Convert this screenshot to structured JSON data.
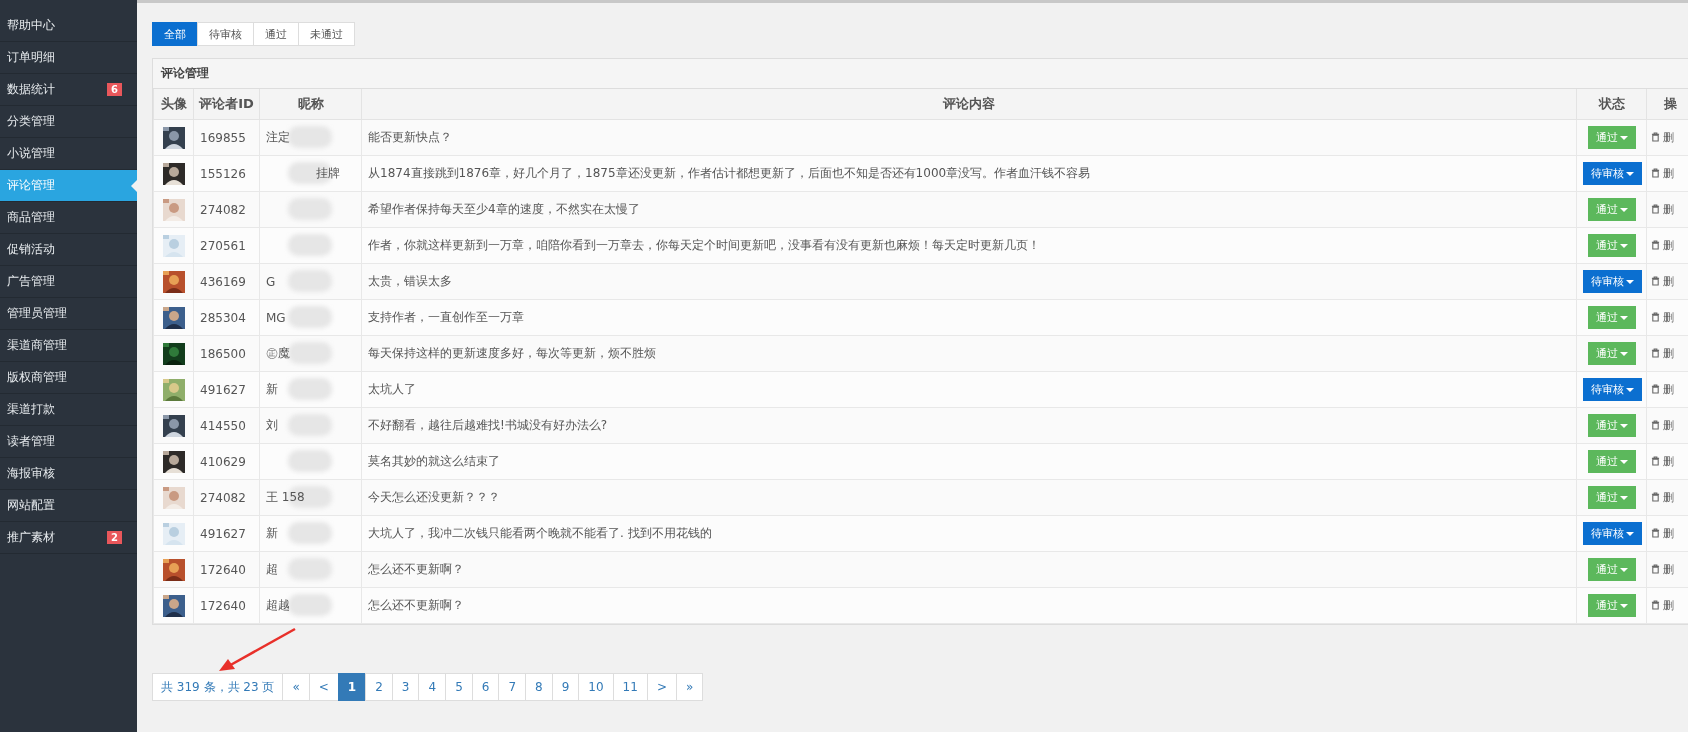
{
  "sidebar": {
    "items": [
      {
        "label": "帮助中心",
        "selected": false
      },
      {
        "label": "订单明细",
        "selected": false
      },
      {
        "label": "数据统计",
        "selected": false,
        "badge": "6"
      },
      {
        "label": "分类管理",
        "selected": false
      },
      {
        "label": "小说管理",
        "selected": false
      },
      {
        "label": "评论管理",
        "selected": true
      },
      {
        "label": "商品管理",
        "selected": false
      },
      {
        "label": "促销活动",
        "selected": false
      },
      {
        "label": "广告管理",
        "selected": false
      },
      {
        "label": "管理员管理",
        "selected": false
      },
      {
        "label": "渠道商管理",
        "selected": false
      },
      {
        "label": "版权商管理",
        "selected": false
      },
      {
        "label": "渠道打款",
        "selected": false
      },
      {
        "label": "读者管理",
        "selected": false
      },
      {
        "label": "海报审核",
        "selected": false
      },
      {
        "label": "网站配置",
        "selected": false
      },
      {
        "label": "推广素材",
        "selected": false,
        "badge": "2"
      }
    ]
  },
  "filter_tabs": [
    {
      "label": "全部",
      "selected": true
    },
    {
      "label": "待审核",
      "selected": false
    },
    {
      "label": "通过",
      "selected": false
    },
    {
      "label": "未通过",
      "selected": false
    }
  ],
  "panel": {
    "title": "评论管理",
    "table": {
      "columns": [
        "头像",
        "评论者ID",
        "昵称",
        "评论内容",
        "状态",
        "操"
      ],
      "rows": [
        {
          "id": "169855",
          "nickname": "注定",
          "content": "能否更新快点？",
          "status": {
            "kind": "approved",
            "label": "通过"
          },
          "action": "删"
        },
        {
          "id": "155126",
          "nickname": "挂牌",
          "content": "从1874直接跳到1876章，好几个月了，1875章还没更新，作者估计都想更新了，后面也不知是否还有1000章没写。作者血汗钱不容易",
          "status": {
            "kind": "pending",
            "label": "待审核"
          },
          "action": "删"
        },
        {
          "id": "274082",
          "content": "希望作者保持每天至少4章的速度，不然实在太慢了",
          "status": {
            "kind": "approved",
            "label": "通过"
          },
          "action": "删"
        },
        {
          "id": "270561",
          "content": "作者，你就这样更新到一万章，咱陪你看到一万章去，你每天定个时间更新吧，没事看有没有更新也麻烦！每天定时更新几页！",
          "status": {
            "kind": "approved",
            "label": "通过"
          },
          "action": "删"
        },
        {
          "id": "436169",
          "nickname": "G",
          "content": "太贵，错误太多",
          "status": {
            "kind": "pending",
            "label": "待审核"
          },
          "action": "删"
        },
        {
          "id": "285304",
          "nickname": "MG",
          "content": "支持作者，一直创作至一万章",
          "status": {
            "kind": "approved",
            "label": "通过"
          },
          "action": "删"
        },
        {
          "id": "186500",
          "nickname": "㊣魔",
          "content": "每天保持这样的更新速度多好，每次等更新，烦不胜烦",
          "status": {
            "kind": "approved",
            "label": "通过"
          },
          "action": "删"
        },
        {
          "id": "491627",
          "nickname": "新",
          "content": "太坑人了",
          "status": {
            "kind": "pending",
            "label": "待审核"
          },
          "action": "删"
        },
        {
          "id": "414550",
          "nickname": "刘",
          "content": "不好翻看，越往后越难找!书城没有好办法么?",
          "status": {
            "kind": "approved",
            "label": "通过"
          },
          "action": "删"
        },
        {
          "id": "410629",
          "content": "莫名其妙的就这么结束了",
          "status": {
            "kind": "approved",
            "label": "通过"
          },
          "action": "删"
        },
        {
          "id": "274082",
          "nickname": "王 158",
          "content": "今天怎么还没更新？？？",
          "status": {
            "kind": "approved",
            "label": "通过"
          },
          "action": "删"
        },
        {
          "id": "491627",
          "nickname": "新",
          "content": "大坑人了，我冲二次钱只能看两个晚就不能看了. 找到不用花钱的",
          "status": {
            "kind": "pending",
            "label": "待审核"
          },
          "action": "删"
        },
        {
          "id": "172640",
          "nickname": "超",
          "content": "怎么还不更新啊？",
          "status": {
            "kind": "approved",
            "label": "通过"
          },
          "action": "删"
        },
        {
          "id": "172640",
          "nickname": "超越",
          "content": "怎么还不更新啊？",
          "status": {
            "kind": "approved",
            "label": "通过"
          },
          "action": "删"
        }
      ]
    }
  },
  "pagination": {
    "summary": "共 319 条，共 23 页",
    "pages": [
      {
        "label": "«",
        "selected": false
      },
      {
        "label": "<",
        "selected": false
      },
      {
        "label": "1",
        "selected": true
      },
      {
        "label": "2",
        "selected": false
      },
      {
        "label": "3",
        "selected": false
      },
      {
        "label": "4",
        "selected": false
      },
      {
        "label": "5",
        "selected": false
      },
      {
        "label": "6",
        "selected": false
      },
      {
        "label": "7",
        "selected": false
      },
      {
        "label": "8",
        "selected": false
      },
      {
        "label": "9",
        "selected": false
      },
      {
        "label": "10",
        "selected": false
      },
      {
        "label": "11",
        "selected": false
      },
      {
        "label": ">",
        "selected": false
      },
      {
        "label": "»",
        "selected": false
      }
    ]
  }
}
